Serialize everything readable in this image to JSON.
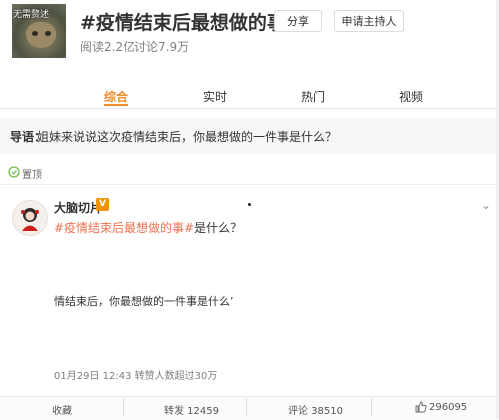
{
  "topic": {
    "image_overlay_text": "无需赘述",
    "title": "#疫情结束后最想做的事#",
    "reads": "阅读2.2亿",
    "discussions": "讨论7.9万",
    "share_button": "分享",
    "apply_host_button": "申请主持人"
  },
  "tabs": [
    {
      "label": "综合",
      "active": true
    },
    {
      "label": "实时",
      "active": false
    },
    {
      "label": "热门",
      "active": false
    },
    {
      "label": "视频",
      "active": false
    }
  ],
  "guide": {
    "label": "导语：",
    "text": "姐妹来说说这次疫情结束后，你最想做的一件事是什么？"
  },
  "pinned": {
    "label": "置顶"
  },
  "post": {
    "author": "大脑切片",
    "verified_badge": "V",
    "hashtag": "#疫情结束后最想做的事#",
    "text_suffix": "是什么？",
    "video_caption": "情结束后，你最想做的一件事是什么’",
    "meta": "01月29日 12:43 转赞人数超过30万",
    "menu_icon": "chevron-down-icon"
  },
  "actions": {
    "favorite": "收藏",
    "repost": "转发 12459",
    "comment": "评论 38510",
    "like": "296095"
  },
  "colors": {
    "accent": "#f28b2c",
    "hashtag": "#eb7350",
    "verified": "#f29200"
  }
}
